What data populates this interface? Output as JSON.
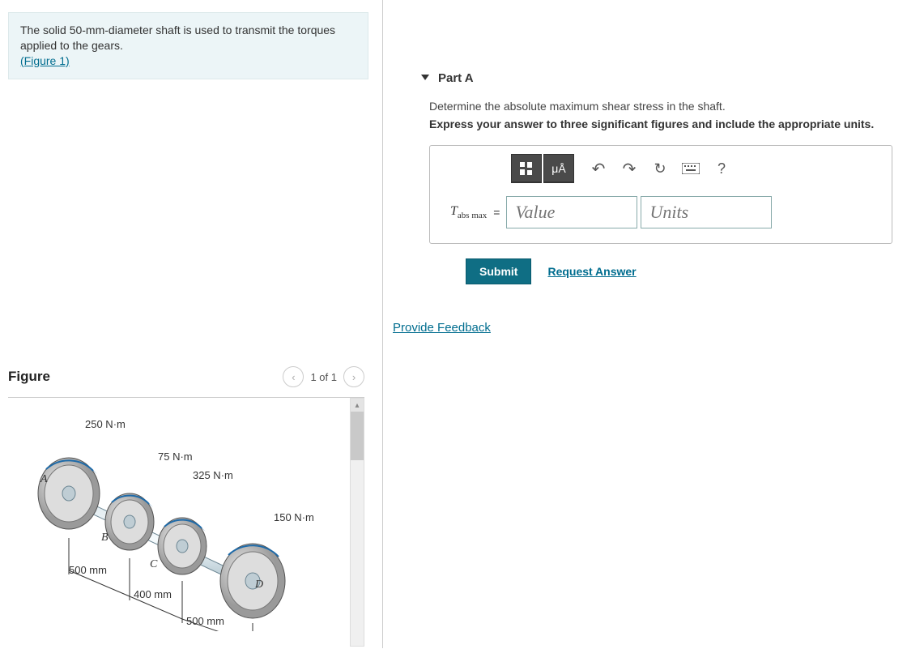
{
  "problem": {
    "text_before": "The solid 50-mm-diameter shaft is used to transmit the torques applied to the gears.",
    "figure_link": "(Figure 1)"
  },
  "part": {
    "label": "Part A",
    "prompt": "Determine the absolute maximum shear stress in the shaft.",
    "instruction": "Express your answer to three significant figures and include the appropriate units."
  },
  "answer": {
    "variable_html": "T",
    "variable_sub": "abs max",
    "value_placeholder": "Value",
    "units_placeholder": "Units",
    "toolbar": {
      "mu_label": "μÅ",
      "undo": "↶",
      "redo": "↷",
      "reset": "↻",
      "keyboard": "⌨",
      "help": "?"
    }
  },
  "actions": {
    "submit": "Submit",
    "request_answer": "Request Answer",
    "feedback": "Provide Feedback"
  },
  "figure": {
    "title": "Figure",
    "page_indicator": "1 of 1",
    "labels": {
      "A": "A",
      "B": "B",
      "C": "C",
      "D": "D"
    },
    "torques": {
      "t1": "250 N·m",
      "t2": "75 N·m",
      "t3": "325 N·m",
      "t4": "150 N·m"
    },
    "dims": {
      "d1": "500 mm",
      "d2": "400 mm",
      "d3": "500 mm"
    }
  }
}
